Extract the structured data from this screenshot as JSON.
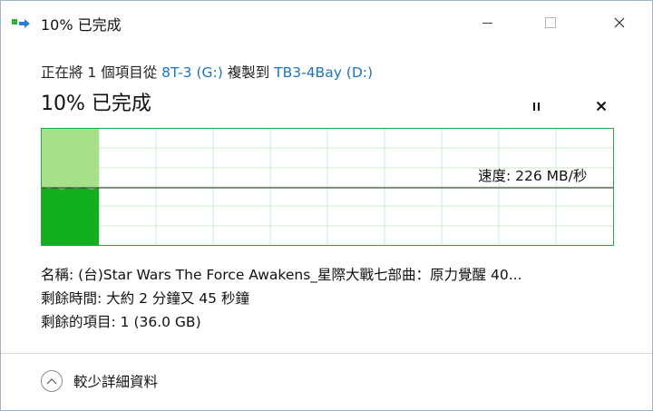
{
  "window": {
    "title": "10% 已完成",
    "colors": {
      "accent_link": "#1a73c8",
      "progress_fill": "#12b01f",
      "progress_history": "#a7e08a",
      "graph_border": "#2aa63c"
    }
  },
  "header": {
    "copy_prefix": "正在將 1 個項目從 ",
    "source": "8T-3 (G:)",
    "copy_middle": " 複製到 ",
    "destination": "TB3-4Bay (D:)",
    "status": "10% 已完成",
    "progress_fraction": 0.1
  },
  "graph": {
    "speed_text": "速度: 226 MB/秒"
  },
  "details": {
    "name": "名稱: (台)Star Wars The Force Awakens_星際大戰七部曲：原力覺醒 40...",
    "time_remaining": "剩餘時間: 大約 2 分鐘又 45 秒鐘",
    "items_remaining": "剩餘的項目: 1 (36.0 GB)"
  },
  "footer": {
    "toggle_label": "較少詳細資料"
  },
  "icons": [
    "copy-app-icon",
    "minimize-icon",
    "maximize-icon",
    "close-icon",
    "pause-icon",
    "stop-icon",
    "chevron-up-icon"
  ]
}
